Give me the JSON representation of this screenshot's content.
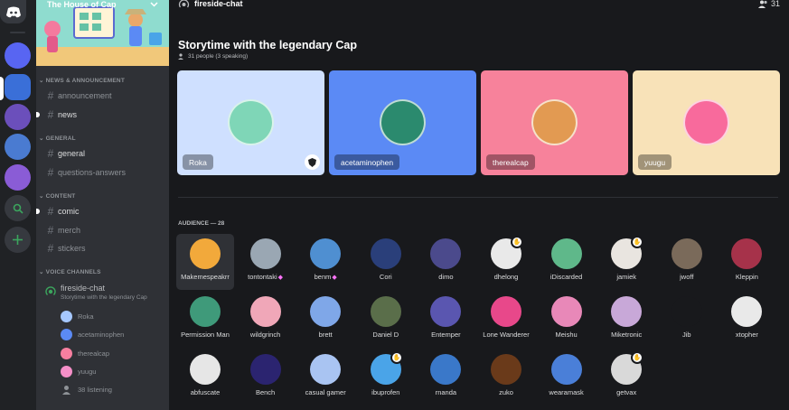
{
  "server": {
    "name": "The House of Cap",
    "rail_colors": [
      "#5865f2",
      "#3a6fd8",
      "#6b4fbb",
      "#4a7bd1",
      "#8a5cd6"
    ]
  },
  "sidebar": {
    "categories": [
      {
        "label": "NEWS & ANNOUNCEMENT",
        "channels": [
          {
            "name": "announcement",
            "bright": false,
            "unread": false
          },
          {
            "name": "news",
            "bright": true,
            "unread": true
          }
        ]
      },
      {
        "label": "GENERAL",
        "channels": [
          {
            "name": "general",
            "bright": true,
            "unread": false
          },
          {
            "name": "questions-answers",
            "bright": false,
            "unread": false
          }
        ]
      },
      {
        "label": "CONTENT",
        "channels": [
          {
            "name": "comic",
            "bright": true,
            "unread": true
          },
          {
            "name": "merch",
            "bright": false,
            "unread": false
          },
          {
            "name": "stickers",
            "bright": false,
            "unread": false
          }
        ]
      }
    ],
    "voice_category": "VOICE CHANNELS",
    "voice_channel": {
      "name": "fireside-chat",
      "topic": "Storytime with the legendary Cap",
      "users": [
        {
          "name": "Roka",
          "color": "#a6c8ff"
        },
        {
          "name": "acetaminophen",
          "color": "#5b8af5"
        },
        {
          "name": "therealcap",
          "color": "#f77fa0"
        },
        {
          "name": "yuugu",
          "color": "#f58fc8"
        }
      ],
      "listening": "38 listening"
    }
  },
  "topbar": {
    "channel": "fireside-chat",
    "count": "31"
  },
  "stage": {
    "title": "Storytime with the legendary Cap",
    "subtitle": "31 people (3 speaking)",
    "speakers": [
      {
        "name": "Roka",
        "bg": "#cfe0ff",
        "avatar": "#7fd6b7",
        "moderator": true
      },
      {
        "name": "acetaminophen",
        "bg": "#5b8af5",
        "avatar": "#2b8a6e",
        "moderator": false
      },
      {
        "name": "therealcap",
        "bg": "#f7829b",
        "avatar": "#e29a52",
        "moderator": false
      },
      {
        "name": "yuugu",
        "bg": "#f8e2b8",
        "avatar": "#f86a9c",
        "moderator": false
      }
    ],
    "audience_header": "AUDIENCE — 28",
    "audience": [
      {
        "name": "Makemespeakrr",
        "color": "#f2a93b",
        "boost": false,
        "hand": false
      },
      {
        "name": "tontontaki",
        "color": "#9aa7b3",
        "boost": true,
        "hand": false
      },
      {
        "name": "benm",
        "color": "#4f8fd1",
        "boost": true,
        "hand": false
      },
      {
        "name": "Cori",
        "color": "#2a3f7a",
        "boost": false,
        "hand": false
      },
      {
        "name": "dimo",
        "color": "#4b4a8c",
        "boost": false,
        "hand": false
      },
      {
        "name": "dhelong",
        "color": "#e9e9e9",
        "boost": false,
        "hand": true
      },
      {
        "name": "iDiscarded",
        "color": "#5fb88a",
        "boost": false,
        "hand": false
      },
      {
        "name": "jamiek",
        "color": "#e9e5e0",
        "boost": false,
        "hand": true
      },
      {
        "name": "jwoff",
        "color": "#7a6a5a",
        "boost": false,
        "hand": false
      },
      {
        "name": "Kleppin",
        "color": "#a6324a",
        "boost": false,
        "hand": false
      },
      {
        "name": "Permission Man",
        "color": "#3f9a7a",
        "boost": false,
        "hand": false
      },
      {
        "name": "wildgrinch",
        "color": "#f0a7b8",
        "boost": false,
        "hand": false
      },
      {
        "name": "brett",
        "color": "#7fa7e8",
        "boost": false,
        "hand": false
      },
      {
        "name": "Daniel D",
        "color": "#5a6e4a",
        "boost": false,
        "hand": false
      },
      {
        "name": "Entemper",
        "color": "#5a56b0",
        "boost": false,
        "hand": false
      },
      {
        "name": "Lone Wanderer",
        "color": "#e8488a",
        "boost": false,
        "hand": false
      },
      {
        "name": "Meishu",
        "color": "#e888b8",
        "boost": false,
        "hand": false
      },
      {
        "name": "Miketronic",
        "color": "#c8a8d8",
        "boost": false,
        "hand": false
      },
      {
        "name": "Jib",
        "color": "#18191c",
        "boost": false,
        "hand": false
      },
      {
        "name": "xtopher",
        "color": "#e9e9e9",
        "boost": false,
        "hand": false
      },
      {
        "name": "abfuscate",
        "color": "#e6e6e6",
        "boost": false,
        "hand": false
      },
      {
        "name": "Bench",
        "color": "#2b2470",
        "boost": false,
        "hand": false
      },
      {
        "name": "casual gamer",
        "color": "#a9c4f2",
        "boost": false,
        "hand": false
      },
      {
        "name": "ibuprofen",
        "color": "#4aa4e8",
        "boost": false,
        "hand": true
      },
      {
        "name": "rnanda",
        "color": "#3a78c9",
        "boost": false,
        "hand": false
      },
      {
        "name": "zuko",
        "color": "#6a3a1a",
        "boost": false,
        "hand": false
      },
      {
        "name": "wearamask",
        "color": "#4a7fd8",
        "boost": false,
        "hand": false
      },
      {
        "name": "getvax",
        "color": "#d9d9d9",
        "boost": false,
        "hand": true
      }
    ]
  }
}
